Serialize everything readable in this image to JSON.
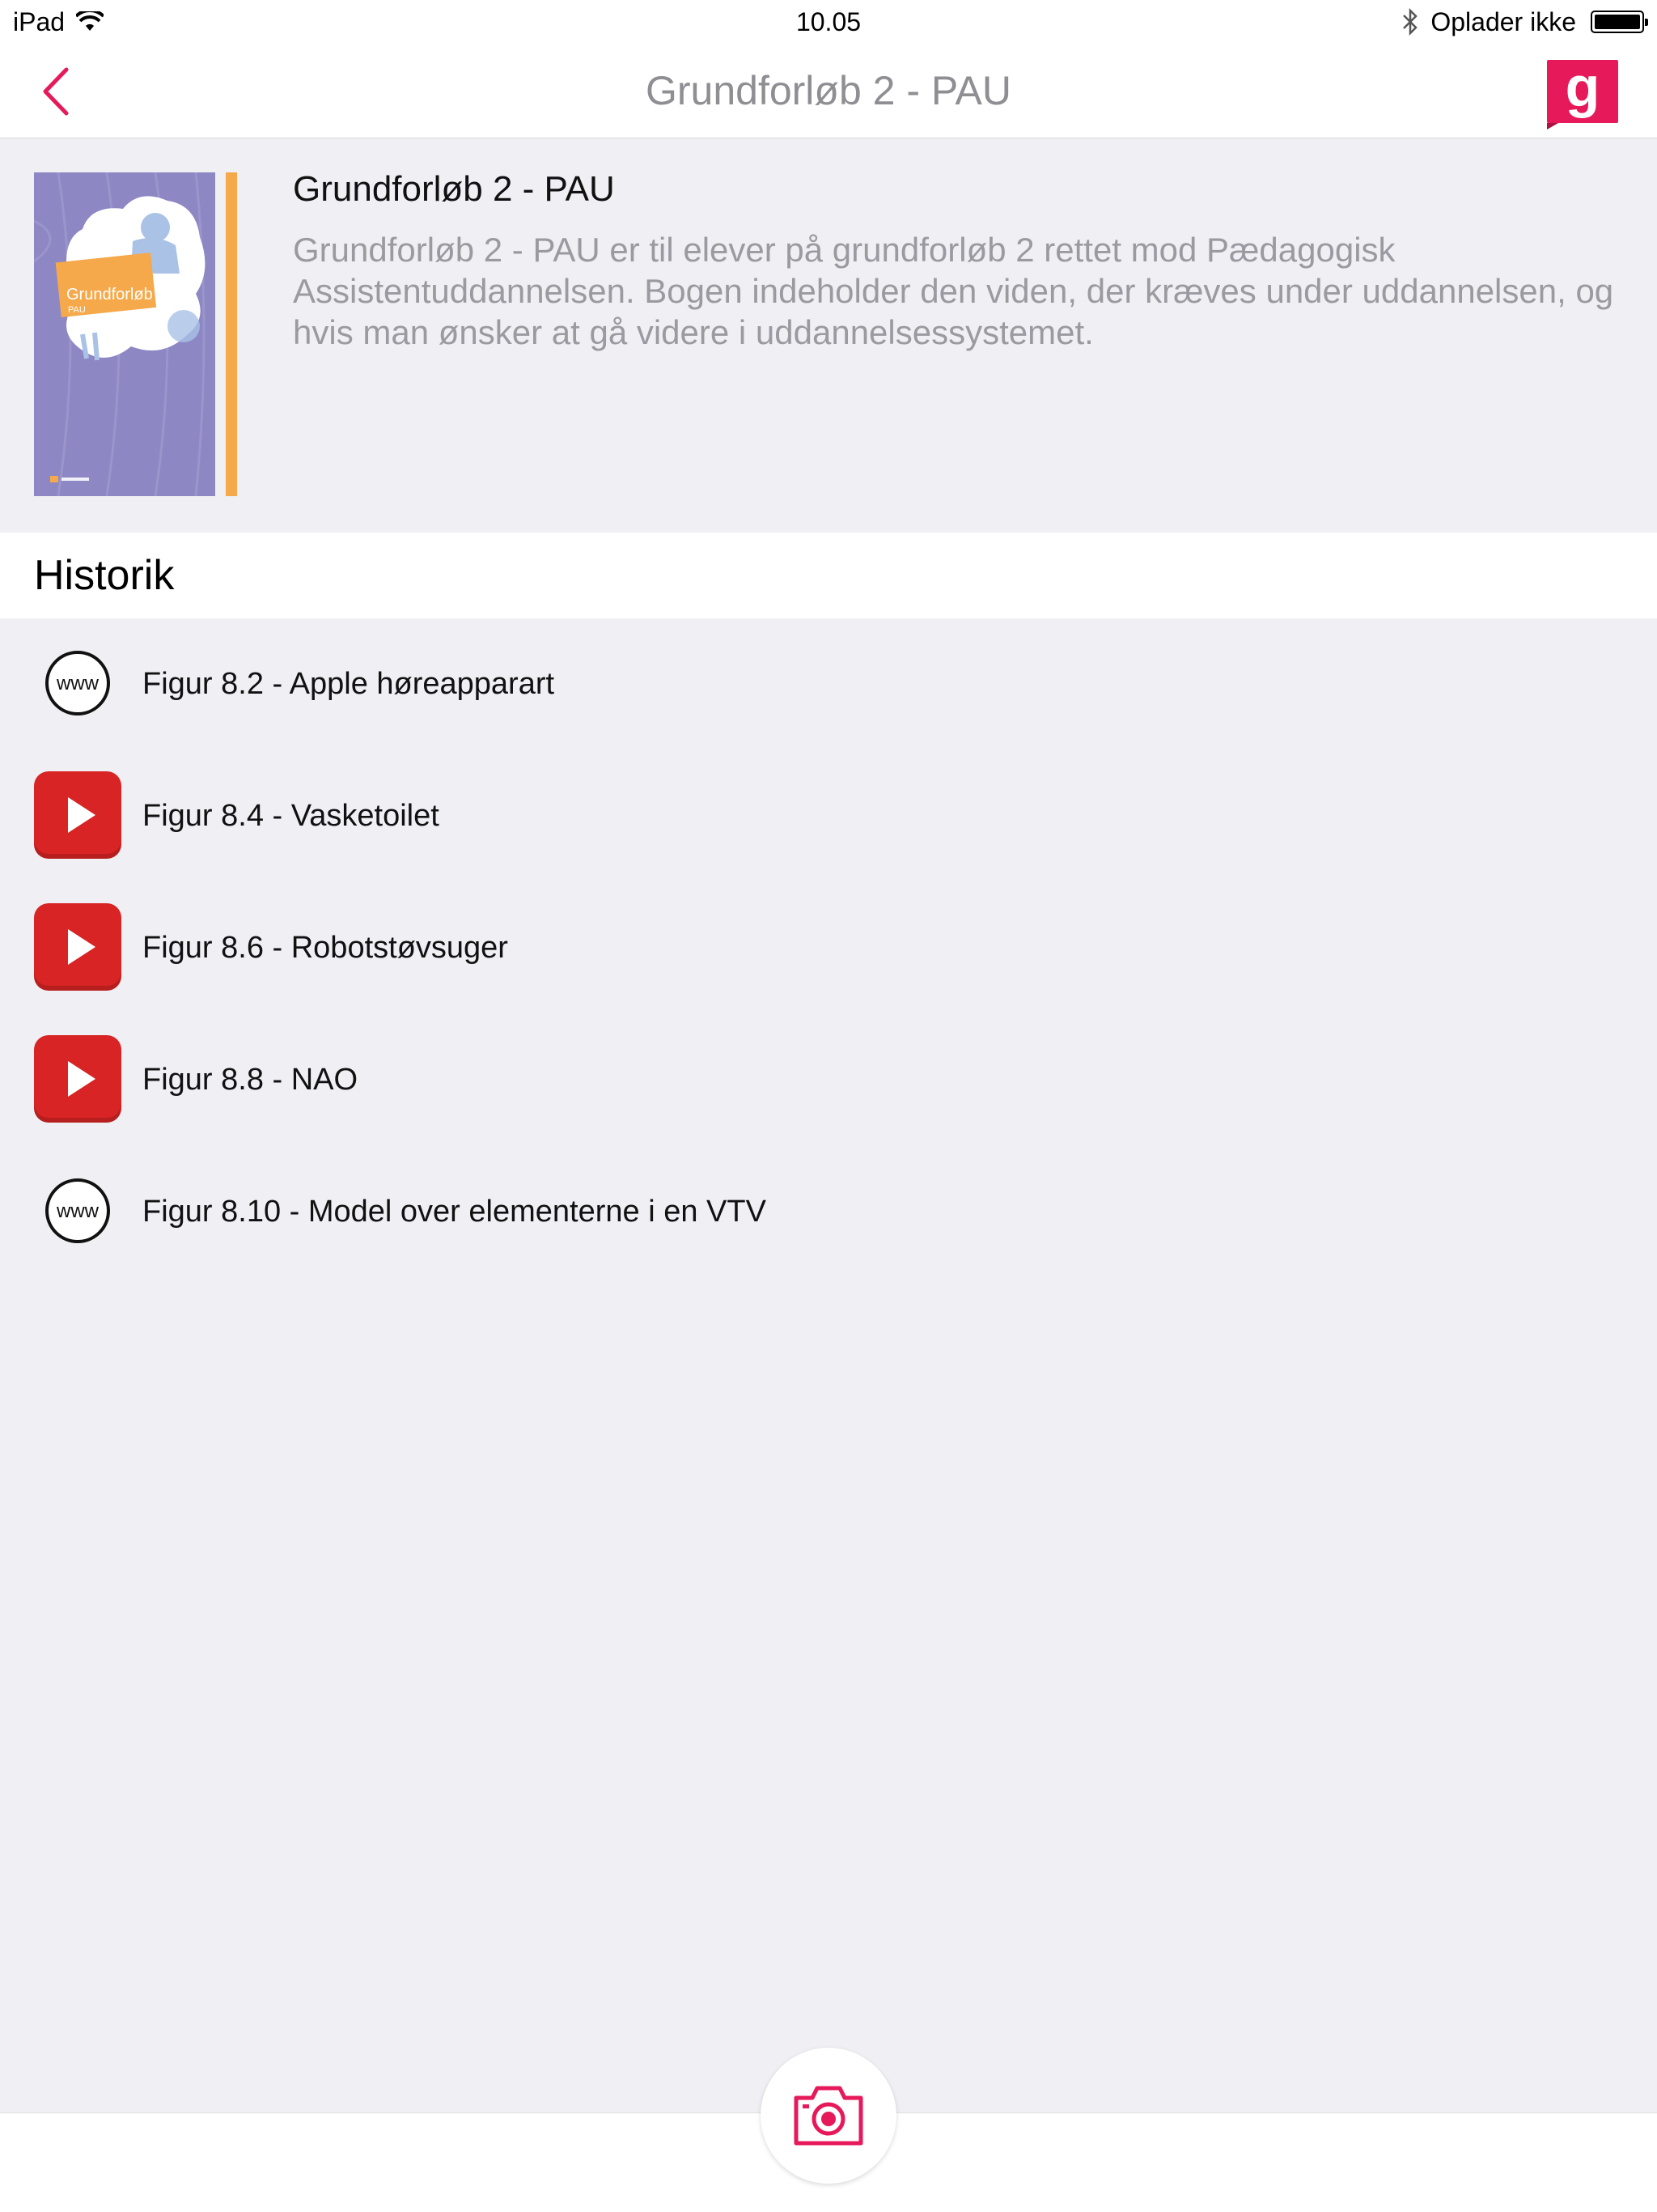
{
  "status_bar": {
    "device": "iPad",
    "time": "10.05",
    "charging_text": "Oplader ikke"
  },
  "nav": {
    "title": "Grundforløb 2 - PAU",
    "logo_letter": "g"
  },
  "book": {
    "title": "Grundforløb 2 - PAU",
    "description": "Grundforløb 2 - PAU er til elever på grundforløb 2 rettet mod Pædagogisk Assistentuddannelsen. Bogen indeholder den viden, der kræves under uddannelsen, og hvis man ønsker at gå videre i uddannelsessystemet.",
    "cover_text": "Grundforløb 2",
    "cover_subtext": "PAU"
  },
  "section": {
    "title": "Historik"
  },
  "history": [
    {
      "label": "Figur 8.2 - Apple høreapparart",
      "icon": "www-icon"
    },
    {
      "label": "Figur 8.4 - Vasketoilet",
      "icon": "youtube-play-icon"
    },
    {
      "label": "Figur 8.6 - Robotstøvsuger",
      "icon": "youtube-play-icon"
    },
    {
      "label": "Figur 8.8 - NAO",
      "icon": "youtube-play-icon"
    },
    {
      "label": "Figur 8.10 - Model over elementerne i en VTV",
      "icon": "www-icon"
    }
  ],
  "colors": {
    "accent": "#e6195a",
    "youtube_red": "#d82424",
    "cover_purple": "#8d87c4",
    "cover_stripe": "#f5a94b",
    "background": "#efeff4"
  }
}
